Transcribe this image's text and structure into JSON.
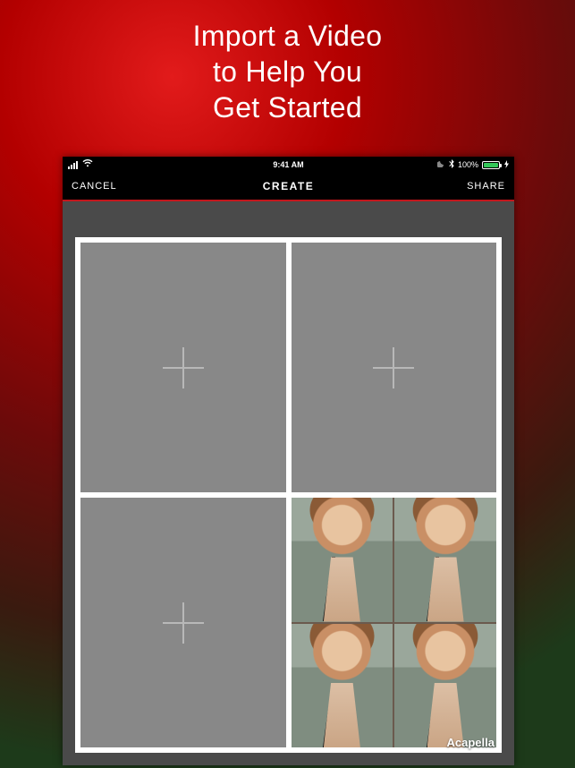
{
  "promo": {
    "line1": "Import a Video",
    "line2": "to Help You",
    "line3": "Get Started"
  },
  "statusbar": {
    "time": "9:41 AM",
    "battery_pct": "100%",
    "icons": {
      "signal": "signal-bars-icon",
      "wifi": "wifi-icon",
      "dnd": "moon-icon",
      "bluetooth": "bluetooth-icon",
      "charging": "charging-icon"
    }
  },
  "navbar": {
    "cancel_label": "CANCEL",
    "title": "CREATE",
    "share_label": "SHARE"
  },
  "editor": {
    "watermark": "Acapella",
    "slots": [
      {
        "state": "empty"
      },
      {
        "state": "empty"
      },
      {
        "state": "empty"
      },
      {
        "state": "filled",
        "thumb_count": 4
      }
    ]
  }
}
